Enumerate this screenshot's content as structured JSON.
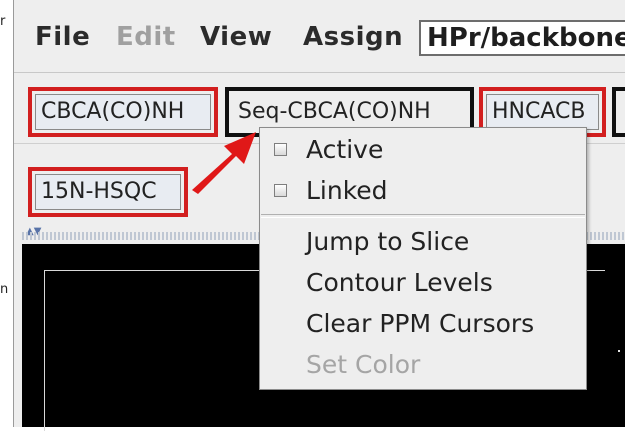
{
  "menubar": {
    "file": "File",
    "edit": "Edit",
    "view": "View",
    "assign": "Assign",
    "spectrum_selector": "HPr/backbone"
  },
  "tabs": [
    {
      "label": "CBCA(CO)NH",
      "outline": "red"
    },
    {
      "label": "Seq-CBCA(CO)NH",
      "outline": "black"
    },
    {
      "label": "HNCACB",
      "outline": "red"
    },
    {
      "label": "15N-HSQC",
      "outline": "red"
    }
  ],
  "context_menu": {
    "active": "Active",
    "linked": "Linked",
    "jump_to_slice": "Jump to Slice",
    "contour_levels": "Contour Levels",
    "clear_ppm_cursors": "Clear PPM Cursors",
    "set_color": "Set Color"
  },
  "side_marks": {
    "top": "r",
    "middle": "n"
  },
  "colors": {
    "highlight_red": "#d21f1f",
    "spectrum_background": "#000000",
    "menu_background": "#eeeeee",
    "disabled_text": "#a5a5a5"
  }
}
